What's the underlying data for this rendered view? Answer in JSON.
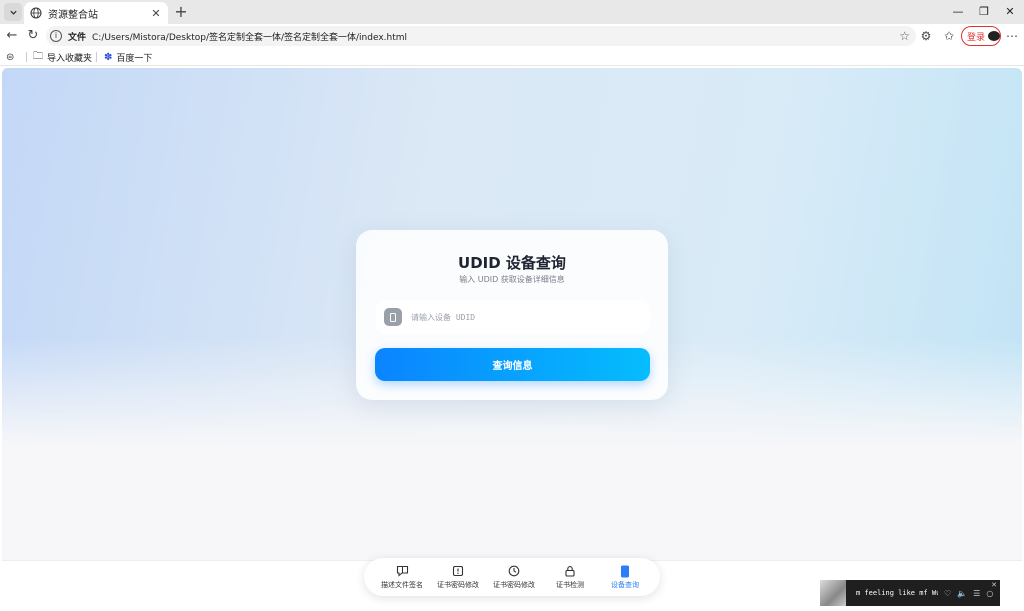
{
  "browser": {
    "tab_title": "资源整合站",
    "scheme_label": "文件",
    "url": "C:/Users/Mistora/Desktop/签名定制全套一体/签名定制全套一体/index.html",
    "login_label": "登录"
  },
  "bookmarks": [
    {
      "label": "导入收藏夹",
      "icon": "folder-import-icon"
    },
    {
      "label": "百度一下",
      "icon": "baidu-paw-icon"
    }
  ],
  "card": {
    "title": "UDID 设备查询",
    "subtitle": "输入 UDID 获取设备详细信息",
    "input_placeholder": "请输入设备 UDID",
    "input_value": "",
    "button_label": "查询信息"
  },
  "bottom_nav": {
    "items": [
      {
        "label": "描述文件签名",
        "icon": "chat-bubble-icon",
        "active": false
      },
      {
        "label": "证书密码修改",
        "icon": "alert-box-icon",
        "active": false
      },
      {
        "label": "证书密码修改",
        "icon": "clock-icon",
        "active": false
      },
      {
        "label": "证书检测",
        "icon": "lock-icon",
        "active": false
      },
      {
        "label": "设备查询",
        "icon": "phone-icon",
        "active": true
      }
    ],
    "active_color": "#2e7cf6"
  },
  "player": {
    "track": "m feeling like mf Wu-"
  },
  "colors": {
    "button_start": "#0b84ff",
    "button_end": "#05bdfd",
    "login_red": "#dd3333"
  }
}
